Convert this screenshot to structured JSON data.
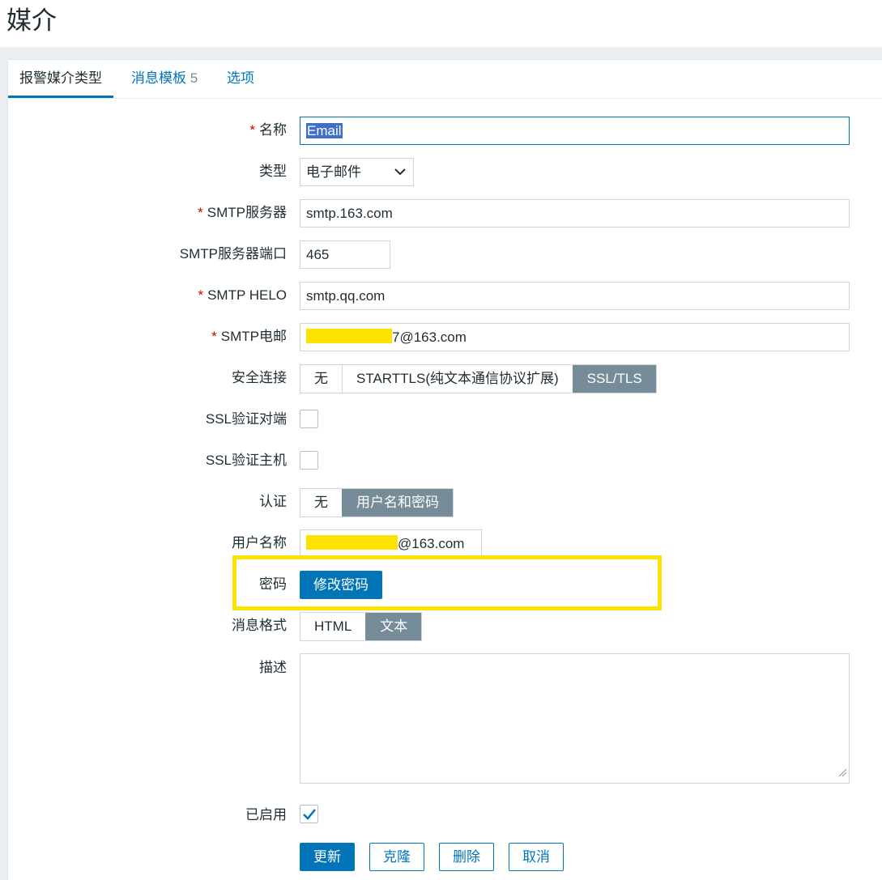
{
  "page": {
    "title": "媒介"
  },
  "tabs": [
    {
      "label": "报警媒介类型"
    },
    {
      "label": "消息模板",
      "count": "5"
    },
    {
      "label": "选项"
    }
  ],
  "form": {
    "name": {
      "label": "名称",
      "value": "Email"
    },
    "type": {
      "label": "类型",
      "value": "电子邮件"
    },
    "smtp_server": {
      "label": "SMTP服务器",
      "value": "smtp.163.com"
    },
    "smtp_port": {
      "label": "SMTP服务器端口",
      "value": "465"
    },
    "smtp_helo": {
      "label": "SMTP HELO",
      "value": "smtp.qq.com"
    },
    "smtp_email": {
      "label": "SMTP电邮",
      "value_suffix": "7@163.com"
    },
    "security": {
      "label": "安全连接",
      "options": [
        "无",
        "STARTTLS(纯文本通信协议扩展)",
        "SSL/TLS"
      ],
      "selected": "SSL/TLS"
    },
    "ssl_verify_peer": {
      "label": "SSL验证对端",
      "checked": false
    },
    "ssl_verify_host": {
      "label": "SSL验证主机",
      "checked": false
    },
    "auth": {
      "label": "认证",
      "options": [
        "无",
        "用户名和密码"
      ],
      "selected": "用户名和密码"
    },
    "username": {
      "label": "用户名称",
      "value_suffix": "@163.com"
    },
    "password": {
      "label": "密码",
      "button": "修改密码"
    },
    "message_format": {
      "label": "消息格式",
      "options": [
        "HTML",
        "文本"
      ],
      "selected": "文本"
    },
    "description": {
      "label": "描述",
      "value": ""
    },
    "enabled": {
      "label": "已启用",
      "checked": true
    }
  },
  "actions": {
    "update": "更新",
    "clone": "克隆",
    "delete": "删除",
    "cancel": "取消"
  },
  "colors": {
    "accent": "#0275b8",
    "segment_selected": "#768d99",
    "required": "#d40000",
    "highlight": "#ffe300"
  }
}
